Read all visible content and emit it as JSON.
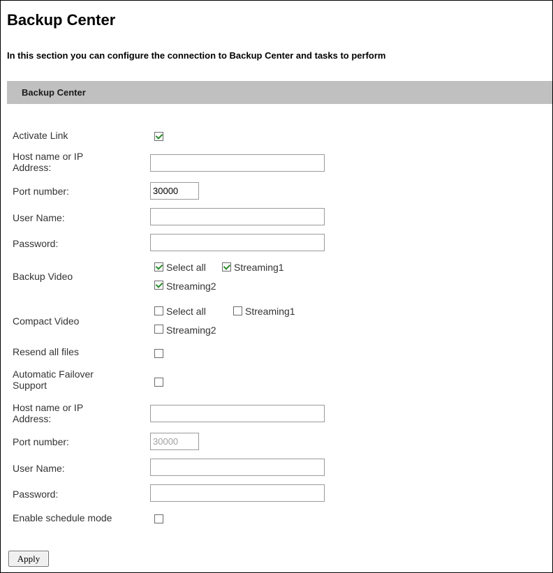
{
  "page": {
    "title": "Backup Center",
    "subtitle": "In this section you can configure the connection to Backup Center and tasks to perform",
    "section_title": "Backup Center"
  },
  "form": {
    "activate_link": {
      "label": "Activate Link",
      "checked": true
    },
    "host1": {
      "label": "Host name or IP Address:",
      "value": ""
    },
    "port1": {
      "label": "Port number:",
      "value": "30000"
    },
    "user1": {
      "label": "User Name:",
      "value": ""
    },
    "password1": {
      "label": "Password:",
      "value": ""
    },
    "backup_video": {
      "label": "Backup Video",
      "select_all": {
        "label": "Select all",
        "checked": true
      },
      "streaming1": {
        "label": "Streaming1",
        "checked": true
      },
      "streaming2": {
        "label": "Streaming2",
        "checked": true
      }
    },
    "compact_video": {
      "label": "Compact Video",
      "select_all": {
        "label": "Select all",
        "checked": false
      },
      "streaming1": {
        "label": "Streaming1",
        "checked": false
      },
      "streaming2": {
        "label": "Streaming2",
        "checked": false
      }
    },
    "resend_all_files": {
      "label": "Resend all files",
      "checked": false
    },
    "failover": {
      "label": "Automatic Failover Support",
      "checked": false
    },
    "host2": {
      "label": "Host name or IP Address:",
      "value": ""
    },
    "port2": {
      "label": "Port number:",
      "value": "30000",
      "disabled": true
    },
    "user2": {
      "label": "User Name:",
      "value": ""
    },
    "password2": {
      "label": "Password:",
      "value": ""
    },
    "schedule_mode": {
      "label": "Enable schedule mode",
      "checked": false
    }
  },
  "buttons": {
    "apply": "Apply"
  },
  "colors": {
    "section_bar": "#c0c0c0",
    "check": "#2a8a2a"
  }
}
